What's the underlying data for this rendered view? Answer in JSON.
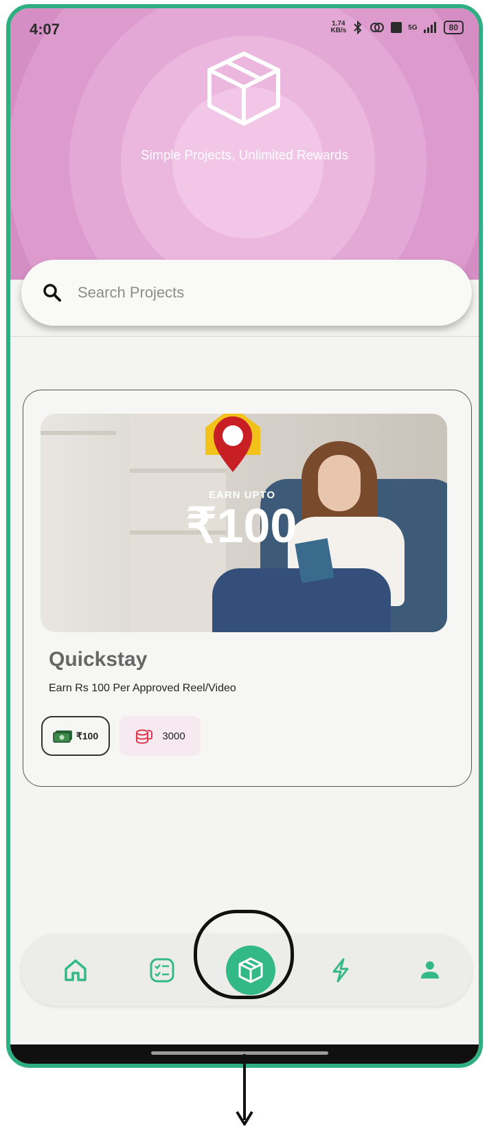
{
  "status_bar": {
    "time": "4:07",
    "net_speed_value": "1.74",
    "net_speed_unit": "KB/s",
    "network": "5G",
    "battery": "80"
  },
  "hero": {
    "tagline": "Simple Projects, Unlimited Rewards",
    "icon": "package-box-icon",
    "bg_color": "#d58ec3"
  },
  "search": {
    "placeholder": "Search Projects",
    "icon": "search-icon"
  },
  "project": {
    "banner_label": "EARN UPTO",
    "banner_amount": "₹100",
    "title": "Quickstay",
    "description": "Earn Rs 100 Per Approved Reel/Video",
    "reward": "₹100",
    "coins": "3000"
  },
  "nav": {
    "items": [
      {
        "name": "home",
        "icon": "home-icon"
      },
      {
        "name": "tasks",
        "icon": "checklist-icon"
      },
      {
        "name": "projects",
        "icon": "package-box-icon",
        "active": true
      },
      {
        "name": "activity",
        "icon": "lightning-icon"
      },
      {
        "name": "profile",
        "icon": "user-icon"
      }
    ],
    "accent": "#33b985"
  },
  "frame_color": "#2fae82"
}
